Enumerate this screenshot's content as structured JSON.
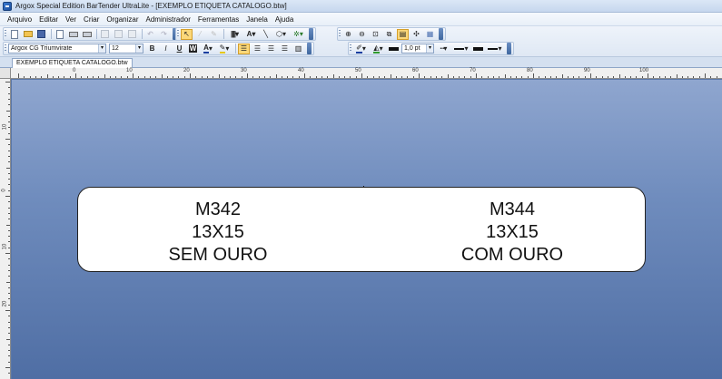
{
  "window": {
    "title": "Argox Special Edition BarTender UltraLite - [EXEMPLO ETIQUETA CATALOGO.btw]"
  },
  "menu": [
    "Arquivo",
    "Editar",
    "Ver",
    "Criar",
    "Organizar",
    "Administrador",
    "Ferramentas",
    "Janela",
    "Ajuda"
  ],
  "format_toolbar": {
    "font": "Argox CG Triumvirate",
    "size": "12",
    "line_weight": "1,0 pt"
  },
  "document_tab": "EXEMPLO ETIQUETA CATALOGO.btw",
  "ruler": {
    "top_labels": [
      "0",
      "10",
      "20",
      "30",
      "40",
      "50",
      "60",
      "70",
      "80",
      "90",
      "100"
    ],
    "left_labels": [
      "10",
      "0",
      "10",
      "20"
    ]
  },
  "label": {
    "left": {
      "code": "M342",
      "size": "13X15",
      "material": "SEM OURO"
    },
    "right": {
      "code": "M344",
      "size": "13X15",
      "material": "COM OURO"
    }
  },
  "colors": {
    "canvas_top": "#8fa6cf",
    "canvas_bottom": "#4f6ea4",
    "active_button": "#fbd87a"
  }
}
